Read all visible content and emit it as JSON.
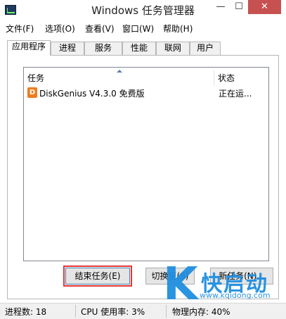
{
  "window": {
    "title": "Windows 任务管理器",
    "minimize_glyph": "—",
    "maximize_glyph": "☐",
    "close_glyph": "✕"
  },
  "menu": [
    "文件(F)",
    "选项(O)",
    "查看(V)",
    "窗口(W)",
    "帮助(H)"
  ],
  "tabs": [
    "应用程序",
    "进程",
    "服务",
    "性能",
    "联网",
    "用户"
  ],
  "active_tab": "应用程序",
  "list": {
    "columns": [
      "任务",
      "状态"
    ],
    "rows": [
      {
        "icon": "diskgenius-icon",
        "icon_glyph": "D",
        "task": "DiskGenius V4.3.0 免费版",
        "status": "正在运..."
      }
    ]
  },
  "buttons": {
    "end_task": "结束任务(E)",
    "switch_to": "切换至(S)",
    "new_task": "新任务(N)..."
  },
  "status": {
    "processes": "进程数: 18",
    "cpu": "CPU 使用率: 3%",
    "memory": "物理内存: 40%"
  },
  "watermark": {
    "letter": "K",
    "text": "快启动",
    "url": "www.kqidong.com"
  },
  "colors": {
    "highlight_outline": "#e53535",
    "watermark": "#1f8fe0",
    "close_button": "#c75050"
  }
}
